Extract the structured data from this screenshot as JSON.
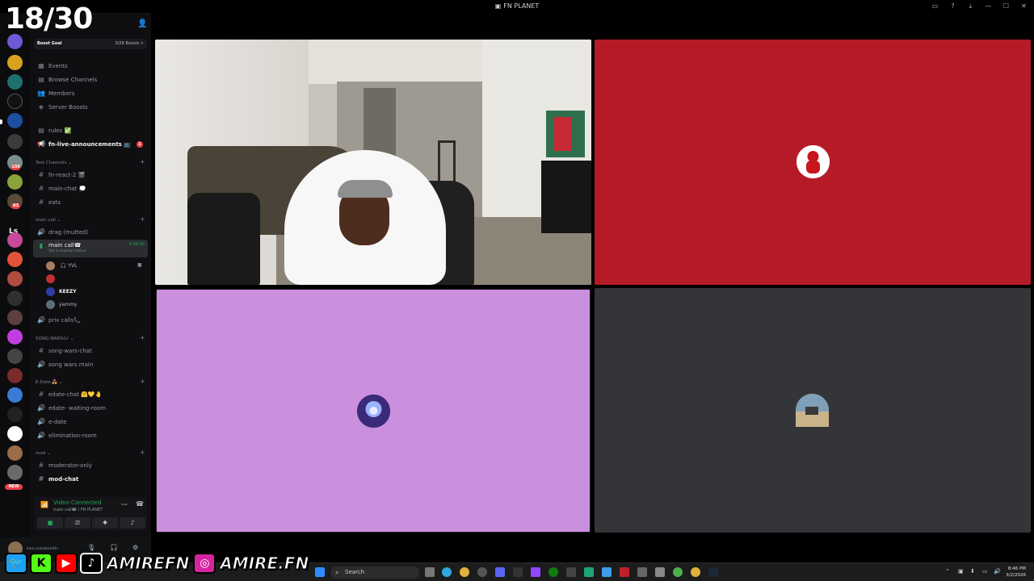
{
  "overlay": {
    "counter": "18/30",
    "handle_1": "AMIREFN",
    "handle_2": "AMIRE.FN"
  },
  "window": {
    "title": "FN PLANET"
  },
  "boost": {
    "label": "Boost Goal",
    "progress": "0/28 Boosts >"
  },
  "nav": [
    {
      "label": "Events",
      "icon": "calendar-icon"
    },
    {
      "label": "Browse Channels",
      "icon": "browse-icon"
    },
    {
      "label": "Members",
      "icon": "members-icon"
    },
    {
      "label": "Server Boosts",
      "icon": "boost-icon"
    }
  ],
  "channels": {
    "rules": "rules ✅",
    "announcements": "fn-live-announcements 📺",
    "announcements_badge": "1",
    "text_category": "Text Channels",
    "fn_react": "fn-react-2 🎬",
    "main_chat": "main-chat 💭",
    "eats": "eats",
    "main_call_category": "main call",
    "drag": "drag (mutted)",
    "main_call": "main call☎",
    "main_call_timer": "4:38:49",
    "main_call_status": "Set a channel status",
    "users": [
      "",
      "",
      "KEEZY",
      "yammy"
    ],
    "user1_suffix": "🎧 YVL",
    "priv_calls": "priv calls📞",
    "songwars_category": "SONG-WARS🎶",
    "songwars_chat": "song-wars-chat",
    "songwars_main": "song wars main",
    "edate_category": "E-Date 💑",
    "edate_chat": "edate-chat 🤗💛🤚",
    "edate_waiting": "edate- waiting-room",
    "edate": "e-date",
    "elimination": "elimination-room",
    "mod_category": "mod",
    "moderator_only": "moderator-only",
    "mod_chat": "mod-chat"
  },
  "voice": {
    "status": "Video Connected",
    "location": "main call☎ / FN PLANET"
  },
  "userpanel": {
    "status": "kick.com/amirefn"
  },
  "rail": {
    "label": "Ls",
    "new_badge": "NEW"
  },
  "taskbar": {
    "search": "Search",
    "time": "8:46 PM",
    "date": "3/2/2026"
  },
  "colors": {
    "tile_red": "#b51b26",
    "tile_purple": "#ca8fdd",
    "tile_gray": "#343538",
    "connected": "#23a55a"
  }
}
